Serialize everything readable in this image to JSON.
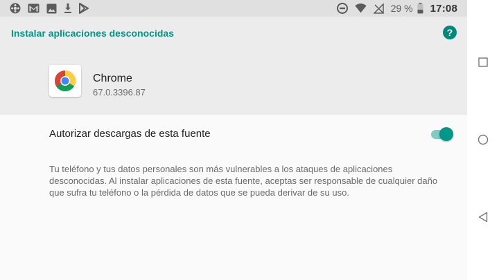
{
  "status_bar": {
    "left_icons": [
      "app-notification-icon",
      "gmail-icon",
      "image-icon",
      "download-icon",
      "play-store-icon"
    ],
    "right_icons": [
      "do-not-disturb-icon",
      "wifi-icon",
      "no-signal-icon",
      "battery-icon"
    ],
    "battery_percent": "29 %",
    "time": "17:08"
  },
  "header": {
    "title": "Instalar aplicaciones desconocidas",
    "help_icon_glyph": "?"
  },
  "app": {
    "name": "Chrome",
    "version": "67.0.3396.87",
    "icon": "chrome-icon"
  },
  "permission": {
    "label": "Autorizar descargas de esta fuente",
    "enabled": true
  },
  "description": "Tu teléfono y tus datos personales son más vulnerables a los ataques de aplicaciones desconocidas. Al instalar aplicaciones de esta fuente, aceptas ser responsable de cualquier daño que sufra tu teléfono o la pérdida de datos que se pueda derivar de su uso.",
  "nav_bar": {
    "buttons": [
      "recents-icon",
      "home-icon",
      "back-icon"
    ]
  },
  "colors": {
    "accent": "#009688",
    "accent_light": "#80cbc4",
    "header_bg": "#ececec",
    "status_bg": "#e0e0e0"
  }
}
